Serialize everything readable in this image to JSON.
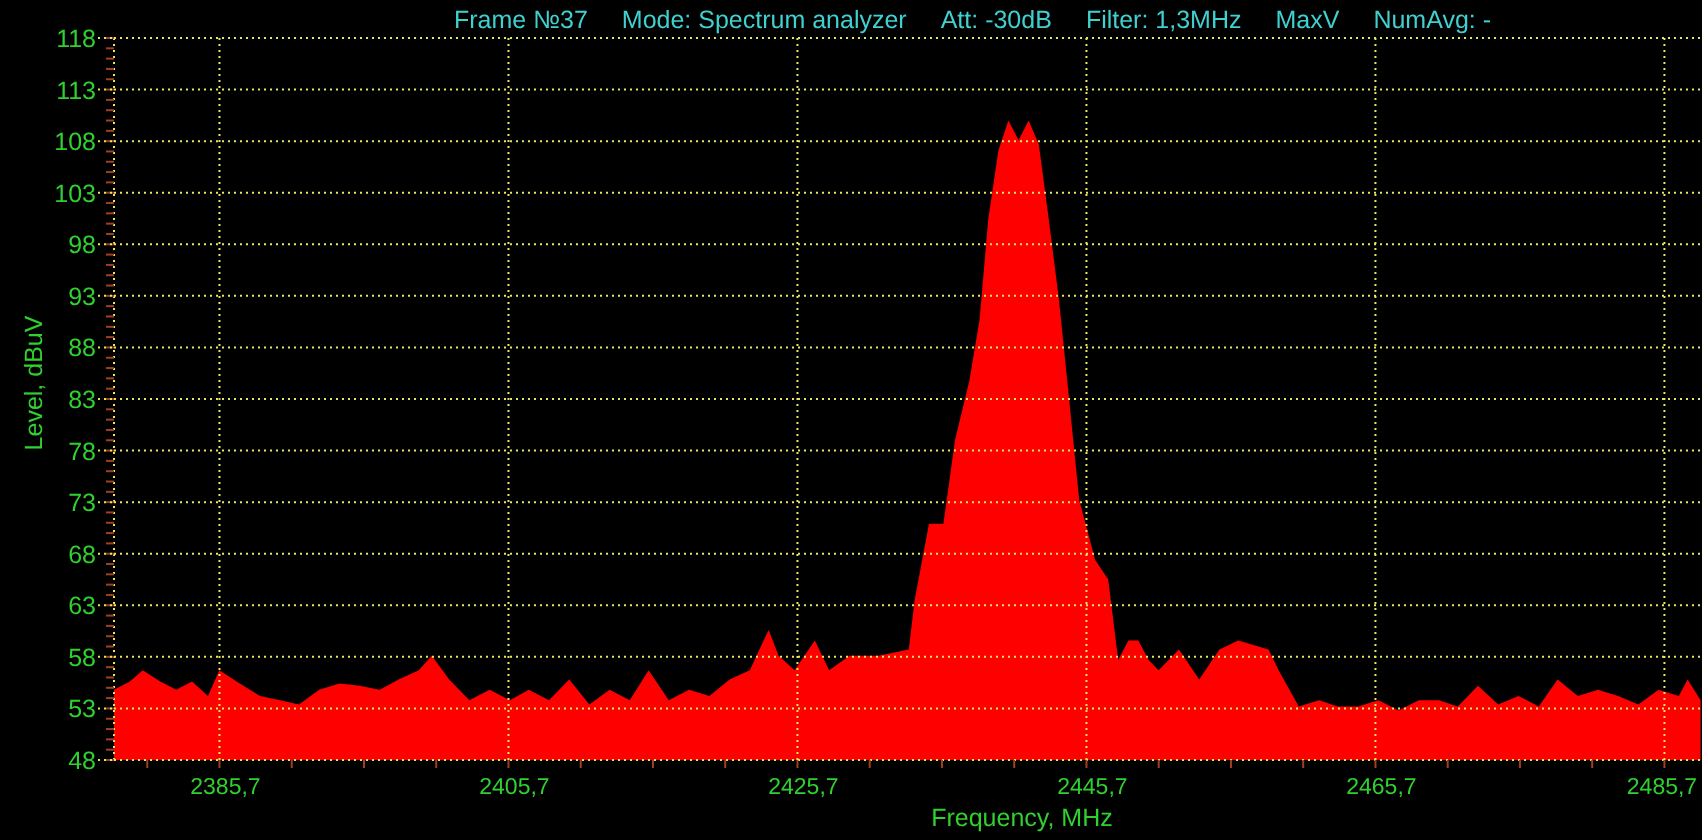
{
  "header": {
    "items": [
      "Frame №37",
      "Mode: Spectrum analyzer",
      "Att: -30dB",
      "Filter: 1,3MHz",
      "MaxV",
      "NumAvg: -"
    ]
  },
  "chart": {
    "chart_data": {
      "type": "area",
      "xlabel": "Frequency, MHz",
      "ylabel": "Level, dBuV",
      "grid": true,
      "xlim": [
        2378.4,
        2488.3
      ],
      "ylim": [
        48,
        118
      ],
      "xticks": [
        {
          "value": 2385.7,
          "label": "2385,7"
        },
        {
          "value": 2405.7,
          "label": "2405,7"
        },
        {
          "value": 2425.7,
          "label": "2425,7"
        },
        {
          "value": 2445.7,
          "label": "2445,7"
        },
        {
          "value": 2465.7,
          "label": "2465,7"
        },
        {
          "value": 2485.7,
          "label": "2485,7"
        }
      ],
      "yticks": [
        48,
        53,
        58,
        63,
        68,
        73,
        78,
        83,
        88,
        93,
        98,
        103,
        108,
        113,
        118
      ],
      "x": [
        2378.4,
        2379.5,
        2380.4,
        2381.6,
        2382.7,
        2383.8,
        2384.9,
        2385.7,
        2387.1,
        2388.5,
        2389.9,
        2391.2,
        2392.6,
        2394.0,
        2395.4,
        2396.8,
        2398.1,
        2399.5,
        2400.4,
        2401.6,
        2403.0,
        2404.4,
        2405.8,
        2407.1,
        2408.5,
        2409.9,
        2411.3,
        2412.7,
        2414.1,
        2415.4,
        2416.8,
        2418.2,
        2419.6,
        2421.0,
        2422.4,
        2423.7,
        2424.4,
        2425.5,
        2426.9,
        2427.9,
        2429.3,
        2431.3,
        2433.4,
        2433.8,
        2434.8,
        2435.8,
        2436.6,
        2437.6,
        2438.3,
        2438.9,
        2439.6,
        2440.3,
        2441.0,
        2441.7,
        2442.4,
        2443.1,
        2443.8,
        2444.5,
        2445.2,
        2446.3,
        2447.2,
        2447.9,
        2448.6,
        2449.3,
        2450.0,
        2450.7,
        2452.1,
        2453.5,
        2454.9,
        2456.2,
        2458.3,
        2459.0,
        2460.4,
        2461.8,
        2463.1,
        2464.5,
        2465.9,
        2467.3,
        2468.7,
        2470.1,
        2471.4,
        2472.8,
        2474.2,
        2475.6,
        2477.0,
        2478.3,
        2479.7,
        2481.1,
        2482.5,
        2483.9,
        2485.3,
        2486.7,
        2487.3,
        2488.2
      ],
      "series": [
        {
          "color": "#ff0000",
          "values": [
            54.8,
            55.6,
            56.7,
            55.6,
            54.8,
            55.6,
            54.2,
            56.7,
            55.4,
            54.2,
            53.8,
            53.4,
            54.8,
            55.4,
            55.2,
            54.8,
            55.8,
            56.7,
            58.1,
            55.8,
            53.8,
            54.8,
            53.8,
            54.8,
            53.8,
            55.8,
            53.4,
            54.8,
            53.8,
            56.7,
            53.8,
            54.8,
            54.2,
            55.8,
            56.7,
            60.6,
            58.1,
            56.7,
            59.6,
            56.7,
            58.1,
            58.1,
            58.7,
            63.5,
            70.9,
            70.9,
            79.0,
            84.8,
            90.7,
            100.4,
            107.1,
            110.0,
            108.1,
            110.0,
            107.7,
            100.4,
            92.6,
            82.9,
            73.2,
            67.4,
            65.5,
            57.7,
            59.6,
            59.6,
            57.7,
            56.7,
            58.7,
            55.8,
            58.7,
            59.6,
            58.7,
            56.7,
            53.2,
            53.8,
            53.2,
            53.2,
            53.8,
            52.8,
            53.8,
            53.8,
            53.2,
            55.2,
            53.4,
            54.2,
            53.2,
            55.8,
            54.2,
            54.8,
            54.2,
            53.4,
            54.8,
            54.2,
            55.8,
            53.8
          ]
        }
      ]
    }
  }
}
